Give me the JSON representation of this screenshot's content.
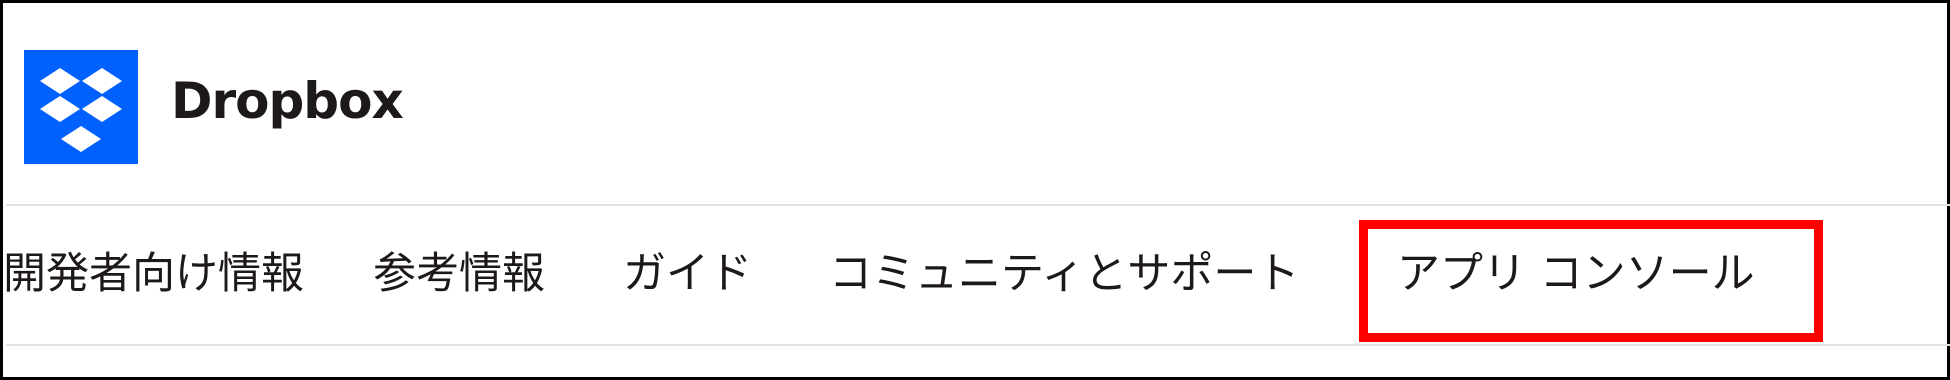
{
  "brand": {
    "name": "Dropbox",
    "logo_icon": "dropbox-logo-icon",
    "logo_color": "#0061fe"
  },
  "nav": {
    "items": [
      {
        "label": "開発者向け情報"
      },
      {
        "label": "参考情報"
      },
      {
        "label": "ガイド"
      },
      {
        "label": "コミュニティとサポート"
      },
      {
        "label": "アプリ コンソール",
        "highlighted": true
      }
    ]
  },
  "colors": {
    "highlight": "#ff0000",
    "text": "#1e1919",
    "divider": "#e2e2e2"
  }
}
